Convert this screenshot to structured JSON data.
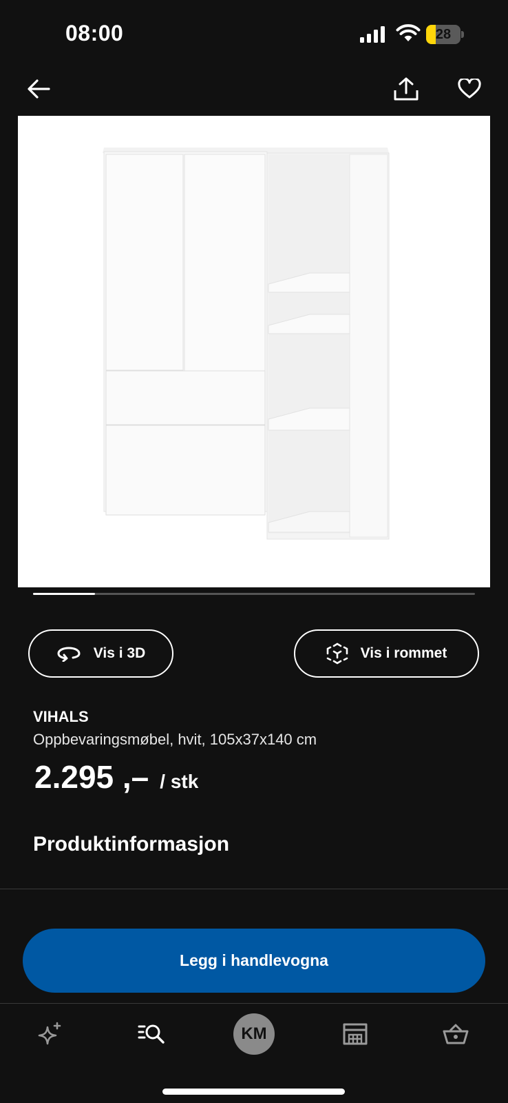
{
  "status_bar": {
    "time": "08:00",
    "battery": "28",
    "battery_level": 0.28
  },
  "header": {
    "back_icon": "arrow-left-icon",
    "share_icon": "share-icon",
    "favorite_icon": "heart-icon"
  },
  "gallery": {
    "image_alt": "VIHALS oppbevaringsmøbel, hvit",
    "progress": 0.14
  },
  "actions": {
    "view_3d": "Vis i 3D",
    "view_room": "Vis i rommet"
  },
  "product": {
    "name": "VIHALS",
    "description": "Oppbevaringsmøbel, hvit, 105x37x140 cm",
    "price": "2.295 ,–",
    "unit": "/ stk"
  },
  "sections": {
    "product_info": "Produktinformasjon"
  },
  "cta": {
    "add_to_cart": "Legg i handlevogna",
    "color": "#0058a3"
  },
  "bottom_nav": {
    "items": [
      {
        "icon": "sparkle-icon"
      },
      {
        "icon": "search-list-icon"
      },
      {
        "avatar": "KM"
      },
      {
        "icon": "store-icon"
      },
      {
        "icon": "basket-icon"
      }
    ]
  }
}
